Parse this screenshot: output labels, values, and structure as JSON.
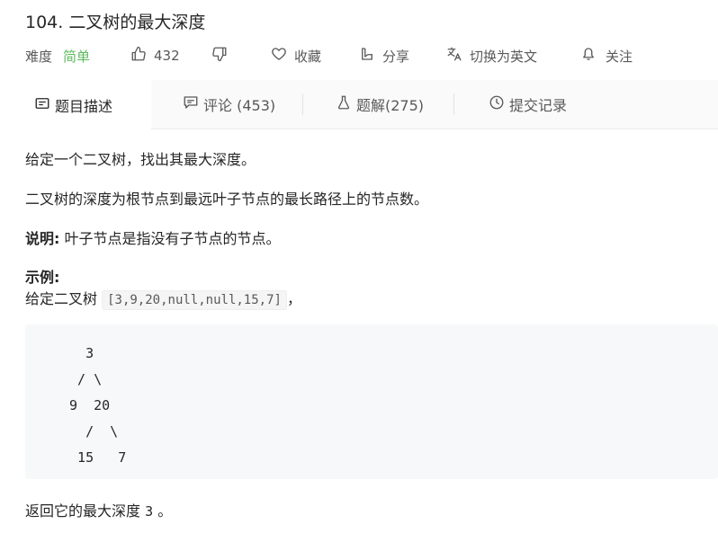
{
  "problem": {
    "title": "104. 二叉树的最大深度",
    "difficulty_label": "难度",
    "difficulty_value": "简单",
    "likes": "432",
    "favorite_label": "收藏",
    "share_label": "分享",
    "switch_lang_label": "切换为英文",
    "follow_label": "关注"
  },
  "tabs": [
    {
      "label": "题目描述"
    },
    {
      "label": "评论 (453)"
    },
    {
      "label": "题解(275)"
    },
    {
      "label": "提交记录"
    }
  ],
  "description": {
    "p1": "给定一个二叉树，找出其最大深度。",
    "p2": "二叉树的深度为根节点到最远叶子节点的最长路径上的节点数。",
    "note_label": "说明:",
    "note_text": " 叶子节点是指没有子节点的节点。",
    "example_label": "示例:",
    "example_prefix": "给定二叉树 ",
    "example_code": "[3,9,20,null,null,15,7]",
    "example_suffix": "，",
    "tree": "   3\n  / \\\n 9  20\n   /  \\\n  15   7",
    "result_prefix": "返回它的最大深度 ",
    "result_value": "3",
    "result_suffix": " 。"
  },
  "colors": {
    "easy": "#5cb85c",
    "text": "#262626",
    "muted": "#595959"
  }
}
